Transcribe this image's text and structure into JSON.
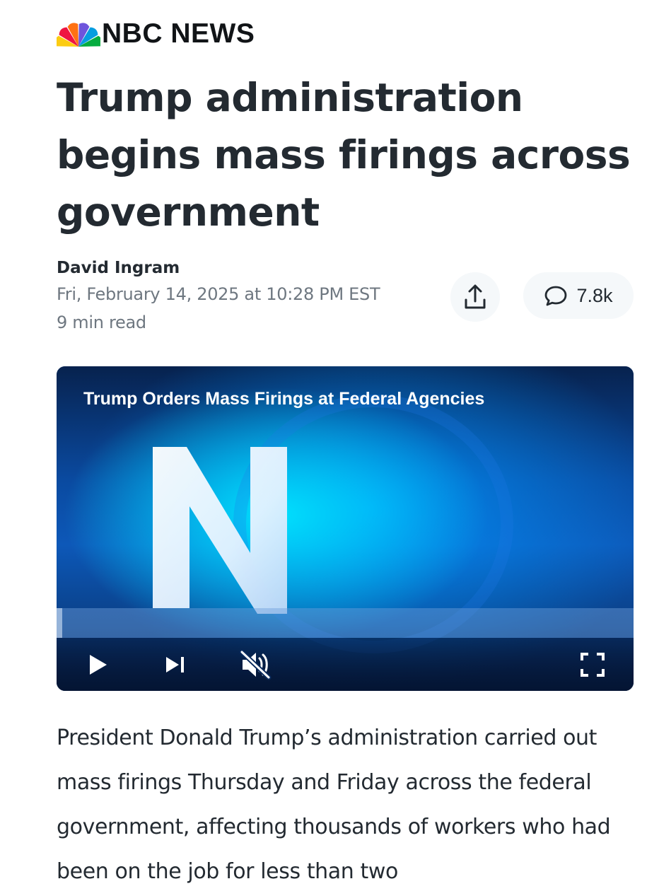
{
  "brand": {
    "name": "NBC NEWS",
    "peacock_colors": [
      "#fccc12",
      "#ef1541",
      "#ff7112",
      "#6e55dc",
      "#069de0",
      "#05ac3f"
    ]
  },
  "article": {
    "headline": "Trump administration begins mass firings across government",
    "author": "David Ingram",
    "timestamp": "Fri, February 14, 2025 at 10:28 PM EST",
    "read_time": "9 min read",
    "body": "President Donald Trump’s administration carried out mass firings Thursday and Friday across the federal government, affecting thousands of workers who had been on the job for less than two"
  },
  "actions": {
    "share_icon": "share-icon",
    "comment_icon": "comment-icon",
    "comment_count": "7.8k"
  },
  "video": {
    "title": "Trump Orders Mass Firings at Federal Agencies",
    "progress": 0.01,
    "muted": true,
    "controls": [
      "play-icon",
      "skip-next-icon",
      "mute-icon",
      "fullscreen-icon"
    ]
  }
}
